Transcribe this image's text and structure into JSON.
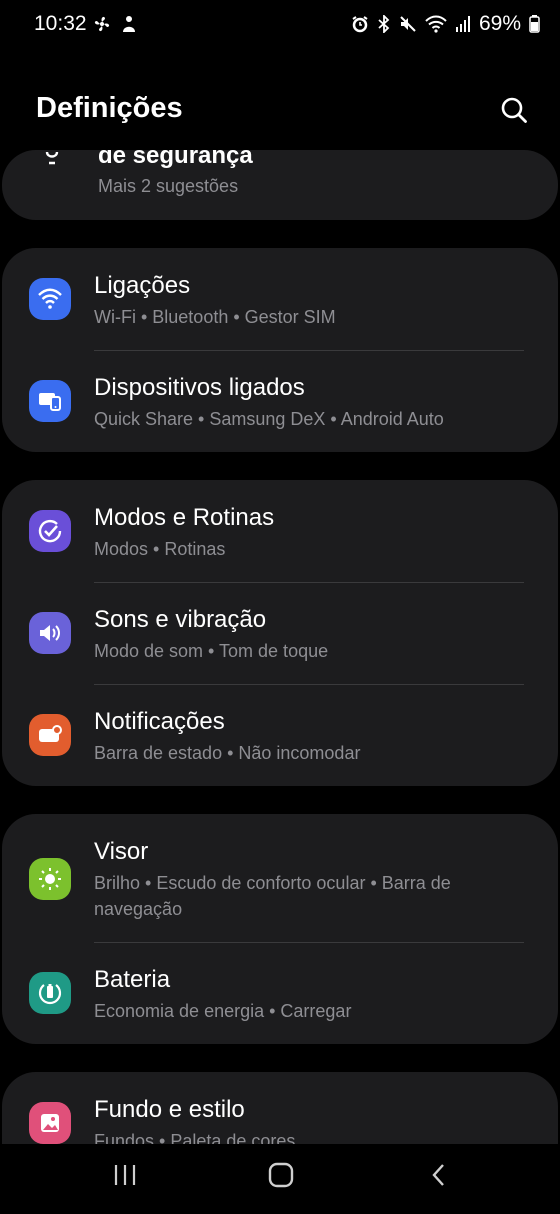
{
  "status": {
    "time": "10:32",
    "battery": "69%",
    "left_icons": [
      "fan-icon",
      "hand-notification-icon"
    ],
    "right_icons": [
      "alarm-icon",
      "bluetooth-icon",
      "mute-icon",
      "wifi-icon",
      "signal-icon",
      "battery-icon"
    ]
  },
  "header": {
    "title": "Definições"
  },
  "suggestion": {
    "title": "de segurança",
    "subtitle": "Mais 2 sugestões"
  },
  "groups": [
    {
      "items": [
        {
          "title": "Ligações",
          "subtitle": "Wi-Fi  •  Bluetooth  •  Gestor SIM",
          "icon": "wifi-icon",
          "color": "#3a6df0"
        },
        {
          "title": "Dispositivos ligados",
          "subtitle": "Quick Share  •  Samsung DeX  •  Android Auto",
          "icon": "devices-icon",
          "color": "#3a6df0"
        }
      ]
    },
    {
      "items": [
        {
          "title": "Modos e Rotinas",
          "subtitle": "Modos  •  Rotinas",
          "icon": "check-circle-icon",
          "color": "#6a4fd8"
        },
        {
          "title": "Sons e vibração",
          "subtitle": "Modo de som  •  Tom de toque",
          "icon": "speaker-icon",
          "color": "#6a62d9"
        },
        {
          "title": "Notificações",
          "subtitle": "Barra de estado  •  Não incomodar",
          "icon": "notification-icon",
          "color": "#e25d2e"
        }
      ]
    },
    {
      "items": [
        {
          "title": "Visor",
          "subtitle": "Brilho  •  Escudo de conforto ocular  •  Barra de navegação",
          "icon": "sun-icon",
          "color": "#7cc12d"
        },
        {
          "title": "Bateria",
          "subtitle": "Economia de energia  •  Carregar",
          "icon": "battery-saver-icon",
          "color": "#1f9a86"
        }
      ]
    },
    {
      "items": [
        {
          "title": "Fundo e estilo",
          "subtitle": "Fundos  •  Paleta de cores",
          "icon": "wallpaper-icon",
          "color": "#e0507a"
        }
      ]
    }
  ]
}
